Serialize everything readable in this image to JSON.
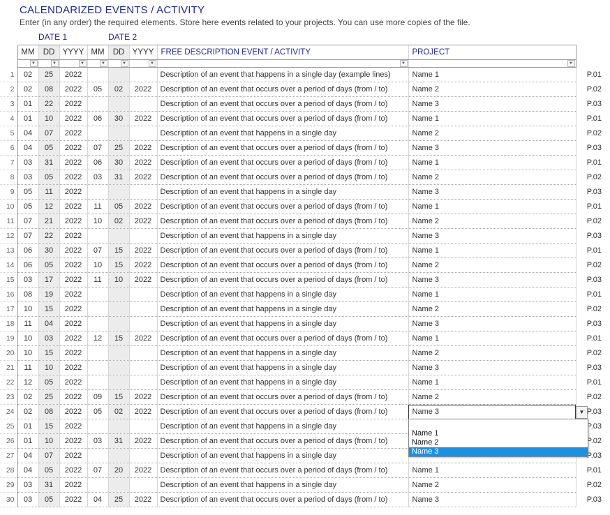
{
  "title": "CALENDARIZED EVENTS / ACTIVITY",
  "subtitle": "Enter (in any order) the required elements. Store here events related to your projects. You can use more copies of the file.",
  "groups": {
    "date1": "DATE 1",
    "date2": "DATE 2"
  },
  "headers": [
    "MM",
    "DD",
    "YYYY",
    "MM",
    "DD",
    "YYYY",
    "FREE DESCRIPTION EVENT / ACTIVITY",
    "PROJECT"
  ],
  "colors": {
    "title": "#1f2a8a",
    "header_text": "#1f2a8a",
    "day_col_bg": "#ececec",
    "dropdown_selected": "#1e90e0"
  },
  "icons": {
    "filter": "filter-dropdown-icon",
    "filter_active": "filter-active-icon",
    "dropdown": "chevron-down-icon"
  },
  "rows": [
    {
      "n": "1",
      "m1": "02",
      "d1": "25",
      "y1": "2022",
      "m2": "",
      "d2": "",
      "y2": "",
      "desc": "Description of an event that happens in a single day (example lines)",
      "proj": "Name 1",
      "code": "P.01"
    },
    {
      "n": "2",
      "m1": "02",
      "d1": "08",
      "y1": "2022",
      "m2": "05",
      "d2": "02",
      "y2": "2022",
      "desc": "Description of an event that occurs over a period of days (from / to)",
      "proj": "Name 2",
      "code": "P.02"
    },
    {
      "n": "3",
      "m1": "01",
      "d1": "22",
      "y1": "2022",
      "m2": "",
      "d2": "",
      "y2": "",
      "desc": "Description of an event that occurs over a period of days (from / to)",
      "proj": "Name 3",
      "code": "P.03"
    },
    {
      "n": "4",
      "m1": "01",
      "d1": "10",
      "y1": "2022",
      "m2": "06",
      "d2": "30",
      "y2": "2022",
      "desc": "Description of an event that occurs over a period of days (from / to)",
      "proj": "Name 1",
      "code": "P.01"
    },
    {
      "n": "5",
      "m1": "04",
      "d1": "07",
      "y1": "2022",
      "m2": "",
      "d2": "",
      "y2": "",
      "desc": "Description of an event that happens in a single day",
      "proj": "Name 2",
      "code": "P.02"
    },
    {
      "n": "6",
      "m1": "04",
      "d1": "05",
      "y1": "2022",
      "m2": "07",
      "d2": "25",
      "y2": "2022",
      "desc": "Description of an event that occurs over a period of days (from / to)",
      "proj": "Name 3",
      "code": "P.03"
    },
    {
      "n": "7",
      "m1": "03",
      "d1": "31",
      "y1": "2022",
      "m2": "06",
      "d2": "30",
      "y2": "2022",
      "desc": "Description of an event that occurs over a period of days (from / to)",
      "proj": "Name 1",
      "code": "P.01"
    },
    {
      "n": "8",
      "m1": "03",
      "d1": "05",
      "y1": "2022",
      "m2": "03",
      "d2": "31",
      "y2": "2022",
      "desc": "Description of an event that occurs over a period of days (from / to)",
      "proj": "Name 2",
      "code": "P.02"
    },
    {
      "n": "9",
      "m1": "05",
      "d1": "11",
      "y1": "2022",
      "m2": "",
      "d2": "",
      "y2": "",
      "desc": "Description of an event that happens in a single day",
      "proj": "Name 3",
      "code": "P.03"
    },
    {
      "n": "10",
      "m1": "05",
      "d1": "12",
      "y1": "2022",
      "m2": "11",
      "d2": "05",
      "y2": "2022",
      "desc": "Description of an event that occurs over a period of days (from / to)",
      "proj": "Name 1",
      "code": "P.01"
    },
    {
      "n": "11",
      "m1": "07",
      "d1": "21",
      "y1": "2022",
      "m2": "10",
      "d2": "02",
      "y2": "2022",
      "desc": "Description of an event that occurs over a period of days (from / to)",
      "proj": "Name 2",
      "code": "P.02"
    },
    {
      "n": "12",
      "m1": "07",
      "d1": "22",
      "y1": "2022",
      "m2": "",
      "d2": "",
      "y2": "",
      "desc": "Description of an event that happens in a single day",
      "proj": "Name 3",
      "code": "P.03"
    },
    {
      "n": "13",
      "m1": "06",
      "d1": "30",
      "y1": "2022",
      "m2": "07",
      "d2": "15",
      "y2": "2022",
      "desc": "Description of an event that occurs over a period of days (from / to)",
      "proj": "Name 1",
      "code": "P.01"
    },
    {
      "n": "14",
      "m1": "06",
      "d1": "05",
      "y1": "2022",
      "m2": "10",
      "d2": "15",
      "y2": "2022",
      "desc": "Description of an event that occurs over a period of days (from / to)",
      "proj": "Name 2",
      "code": "P.02"
    },
    {
      "n": "15",
      "m1": "03",
      "d1": "17",
      "y1": "2022",
      "m2": "11",
      "d2": "10",
      "y2": "2022",
      "desc": "Description of an event that occurs over a period of days (from / to)",
      "proj": "Name 3",
      "code": "P.03"
    },
    {
      "n": "16",
      "m1": "08",
      "d1": "19",
      "y1": "2022",
      "m2": "",
      "d2": "",
      "y2": "",
      "desc": "Description of an event that happens in a single day",
      "proj": "Name 1",
      "code": "P.01"
    },
    {
      "n": "17",
      "m1": "10",
      "d1": "15",
      "y1": "2022",
      "m2": "",
      "d2": "",
      "y2": "",
      "desc": "Description of an event that happens in a single day",
      "proj": "Name 2",
      "code": "P.02"
    },
    {
      "n": "18",
      "m1": "11",
      "d1": "04",
      "y1": "2022",
      "m2": "",
      "d2": "",
      "y2": "",
      "desc": "Description of an event that happens in a single day",
      "proj": "Name 3",
      "code": "P.03"
    },
    {
      "n": "19",
      "m1": "10",
      "d1": "03",
      "y1": "2022",
      "m2": "12",
      "d2": "15",
      "y2": "2022",
      "desc": "Description of an event that occurs over a period of days (from / to)",
      "proj": "Name 1",
      "code": "P.01"
    },
    {
      "n": "20",
      "m1": "10",
      "d1": "15",
      "y1": "2022",
      "m2": "",
      "d2": "",
      "y2": "",
      "desc": "Description of an event that happens in a single day",
      "proj": "Name 2",
      "code": "P.02"
    },
    {
      "n": "21",
      "m1": "11",
      "d1": "10",
      "y1": "2022",
      "m2": "",
      "d2": "",
      "y2": "",
      "desc": "Description of an event that happens in a single day",
      "proj": "Name 3",
      "code": "P.03"
    },
    {
      "n": "22",
      "m1": "12",
      "d1": "05",
      "y1": "2022",
      "m2": "",
      "d2": "",
      "y2": "",
      "desc": "Description of an event that happens in a single day",
      "proj": "Name 1",
      "code": "P.01"
    },
    {
      "n": "23",
      "m1": "02",
      "d1": "25",
      "y1": "2022",
      "m2": "09",
      "d2": "15",
      "y2": "2022",
      "desc": "Description of an event that occurs over a period of days (from / to)",
      "proj": "Name 2",
      "code": "P.02"
    },
    {
      "n": "24",
      "m1": "02",
      "d1": "08",
      "y1": "2022",
      "m2": "05",
      "d2": "02",
      "y2": "2022",
      "desc": "Description of an event that occurs over a period of days (from / to)",
      "proj": "Name 3",
      "code": "P.03"
    },
    {
      "n": "25",
      "m1": "01",
      "d1": "15",
      "y1": "2022",
      "m2": "",
      "d2": "",
      "y2": "",
      "desc": "Description of an event that happens in a single day",
      "proj": "",
      "code": "P.03"
    },
    {
      "n": "26",
      "m1": "01",
      "d1": "10",
      "y1": "2022",
      "m2": "03",
      "d2": "31",
      "y2": "2022",
      "desc": "Description of an event that occurs over a period of days (from / to)",
      "proj": "",
      "code": "P.02"
    },
    {
      "n": "27",
      "m1": "04",
      "d1": "07",
      "y1": "2022",
      "m2": "",
      "d2": "",
      "y2": "",
      "desc": "Description of an event that happens in a single day",
      "proj": "",
      "code": "P.03"
    },
    {
      "n": "28",
      "m1": "04",
      "d1": "05",
      "y1": "2022",
      "m2": "07",
      "d2": "20",
      "y2": "2022",
      "desc": "Description of an event that occurs over a period of days (from / to)",
      "proj": "Name 1",
      "code": "P.01"
    },
    {
      "n": "29",
      "m1": "03",
      "d1": "31",
      "y1": "2022",
      "m2": "",
      "d2": "",
      "y2": "",
      "desc": "Description of an event that happens in a single day",
      "proj": "Name 2",
      "code": "P.02"
    },
    {
      "n": "30",
      "m1": "03",
      "d1": "05",
      "y1": "2022",
      "m2": "04",
      "d2": "25",
      "y2": "2022",
      "desc": "Description of an event that occurs over a period of days (from / to)",
      "proj": "Name 3",
      "code": "P.03"
    }
  ],
  "dropdown": {
    "options": [
      "Name 1",
      "Name 2",
      "Name 3"
    ],
    "selected": "Name 3"
  }
}
